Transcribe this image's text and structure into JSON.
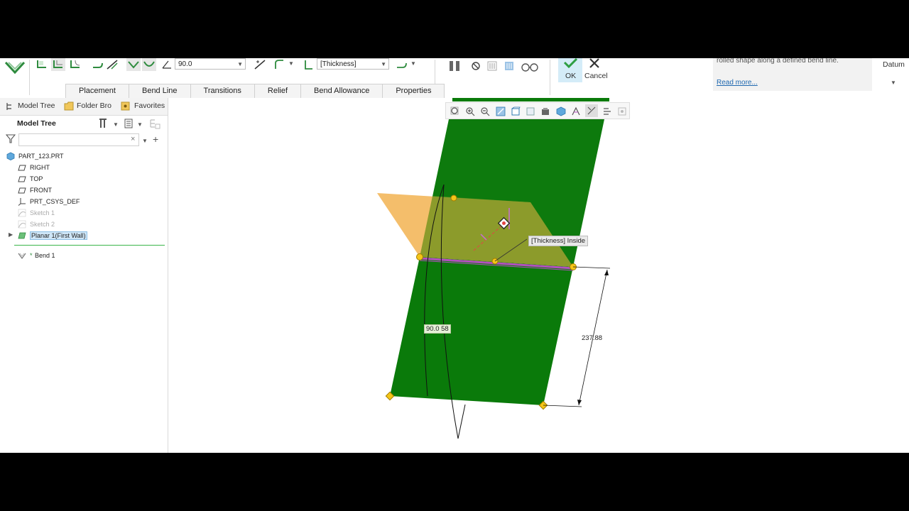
{
  "ribbon": {
    "angle_value": "90.0",
    "thickness_value": "[Thickness]",
    "ok_label": "OK",
    "cancel_label": "Cancel",
    "info_text": "rolled shape along a defined bend line.",
    "read_more": "Read more...",
    "datum_label": "Datum",
    "tabs": [
      "Placement",
      "Bend Line",
      "Transitions",
      "Relief",
      "Bend Allowance",
      "Properties"
    ]
  },
  "left_panel": {
    "tabs": [
      "Model Tree",
      "Folder Bro",
      "Favorites"
    ],
    "header": "Model Tree",
    "filter_value": "",
    "tree": [
      {
        "label": "PART_123.PRT",
        "icon": "part-icon"
      },
      {
        "label": "RIGHT",
        "icon": "datum-plane-icon"
      },
      {
        "label": "TOP",
        "icon": "datum-plane-icon"
      },
      {
        "label": "FRONT",
        "icon": "datum-plane-icon"
      },
      {
        "label": "PRT_CSYS_DEF",
        "icon": "csys-icon"
      },
      {
        "label": "Sketch 1",
        "icon": "sketch-icon"
      },
      {
        "label": "Sketch 2",
        "icon": "sketch-icon"
      },
      {
        "label": "Planar 1(First Wall)",
        "icon": "planar-wall-icon"
      },
      {
        "label": "Bend 1",
        "icon": "bend-icon"
      }
    ]
  },
  "graphics": {
    "tooltip": "[Thickness] Inside",
    "dimension_length": "237.88",
    "angle_dim": "90.0",
    "angle_dim_suffix": "58"
  },
  "colors": {
    "wall_green": "#0d7a0d",
    "preview_orange": "#f0a83a",
    "ok_highlight": "#d4ecf8",
    "selection_blue": "#cfe6f7",
    "link_blue": "#1f68b0",
    "bend_magenta": "#b34fbf"
  }
}
